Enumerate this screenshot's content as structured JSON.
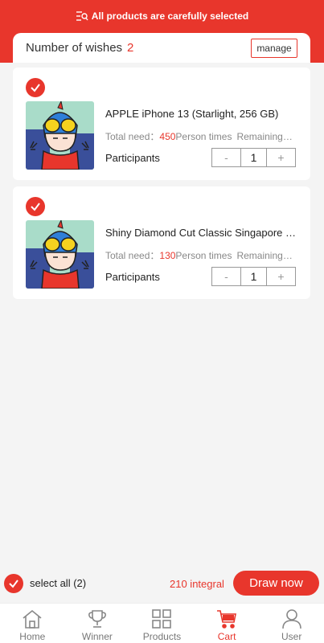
{
  "banner": {
    "text": "All products are carefully selected",
    "icon": "search-list-icon"
  },
  "wishes": {
    "label": "Number of wishes",
    "count": "2",
    "manage_label": "manage"
  },
  "products": [
    {
      "title": "APPLE iPhone 13 (Starlight, 256 GB)",
      "total_need_label": "Total need：",
      "total_need_value": "450",
      "total_need_unit": "Person times",
      "remaining_label": "Remaining…",
      "participants_label": "Participants",
      "quantity": "1",
      "minus": "-",
      "plus": "+",
      "selected": true
    },
    {
      "title": "Shiny Diamond Cut Classic Singapore Chain",
      "total_need_label": "Total need：",
      "total_need_value": "130",
      "total_need_unit": "Person times",
      "remaining_label": "Remaining…",
      "participants_label": "Participants",
      "quantity": "1",
      "minus": "-",
      "plus": "+",
      "selected": true
    }
  ],
  "footer": {
    "select_all_label": "select all (2)",
    "integral_label": "210 integral",
    "draw_label": "Draw now"
  },
  "tabs": [
    {
      "label": "Home",
      "icon": "home-icon",
      "active": false
    },
    {
      "label": "Winner",
      "icon": "trophy-icon",
      "active": false
    },
    {
      "label": "Products",
      "icon": "grid-icon",
      "active": false
    },
    {
      "label": "Cart",
      "icon": "cart-icon",
      "active": true
    },
    {
      "label": "User",
      "icon": "user-icon",
      "active": false
    }
  ],
  "colors": {
    "accent": "#e8362c",
    "background": "#f4f4f4"
  }
}
